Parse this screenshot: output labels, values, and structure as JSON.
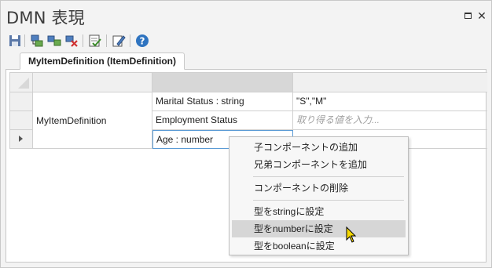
{
  "window": {
    "title": "DMN 表現",
    "maximize_icon": "maximize-icon",
    "close_glyph": "✕"
  },
  "toolbar": {
    "buttons": [
      {
        "name": "save-icon"
      },
      {
        "name": "add-child-icon"
      },
      {
        "name": "add-sibling-icon"
      },
      {
        "name": "delete-icon"
      },
      {
        "name": "validate-icon"
      },
      {
        "name": "edit-icon"
      },
      {
        "name": "help-icon"
      }
    ]
  },
  "tab": {
    "label": "MyItemDefinition (ItemDefinition)"
  },
  "grid": {
    "item_name": "MyItemDefinition",
    "rows": [
      {
        "component": "Marital Status : string",
        "values": "\"S\",\"M\"",
        "values_is_placeholder": false
      },
      {
        "component": "Employment Status",
        "values": "取り得る値を入力...",
        "values_is_placeholder": true
      },
      {
        "component": "Age : number",
        "values": "",
        "values_is_placeholder": false
      }
    ]
  },
  "context_menu": {
    "items": [
      {
        "label": "子コンポーネントの追加"
      },
      {
        "label": "兄弟コンポーネントを追加"
      },
      {
        "label": "コンポーネントの削除"
      },
      {
        "label": "型をstringに設定"
      },
      {
        "label": "型をnumberに設定",
        "highlighted": true
      },
      {
        "label": "型をbooleanに設定"
      }
    ]
  },
  "colors": {
    "accent": "#5b9bd5",
    "highlight": "#d6d6d6",
    "header": "#f0f0f0"
  }
}
